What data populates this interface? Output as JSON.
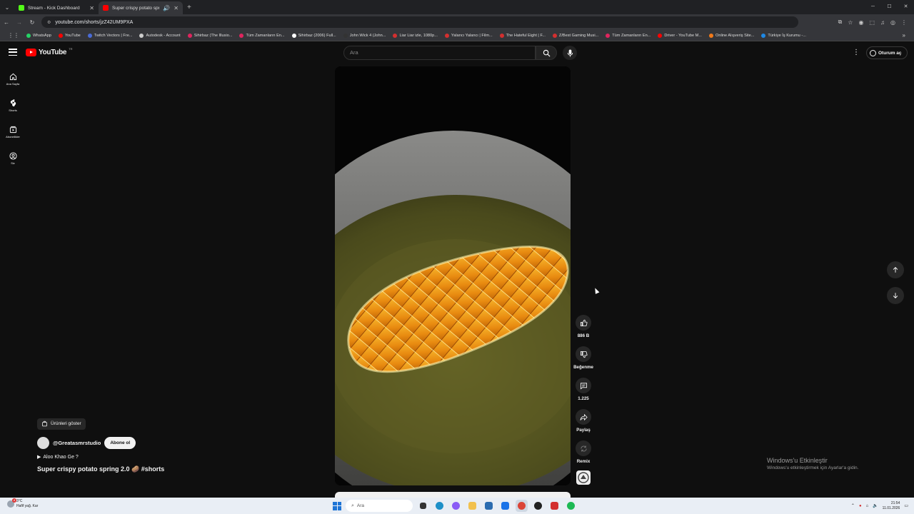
{
  "browser": {
    "tabs": [
      {
        "title": "Stream - Kick Dashboard",
        "favicon_color": "#53fc18",
        "active": false
      },
      {
        "title": "Super crispy potato spring",
        "favicon_color": "#ff0000",
        "active": true
      }
    ],
    "new_tab": "+",
    "window_controls": {
      "minimize": "─",
      "maximize": "☐",
      "close": "✕"
    },
    "url": "youtube.com/shorts/jzZ42UM9PXA",
    "bookmarks": [
      {
        "label": "WhatsApp",
        "color": "#25d366"
      },
      {
        "label": "YouTube",
        "color": "#ff0000"
      },
      {
        "label": "Twitch Vectors | Fre...",
        "color": "#4a6bd6"
      },
      {
        "label": "Autodesk - Account",
        "color": "#cccccc"
      },
      {
        "label": "Sihirbaz (The Illusio...",
        "color": "#e0245e"
      },
      {
        "label": "Tüm Zamanların En...",
        "color": "#e0245e"
      },
      {
        "label": "Sihirbaz (2006) Full...",
        "color": "#ffffff"
      },
      {
        "label": "John Wick 4 (John...",
        "color": "#333333"
      },
      {
        "label": "Liar Liar izle, 1080p...",
        "color": "#d32f2f"
      },
      {
        "label": "Yalancı Yalancı | Film...",
        "color": "#d32f2f"
      },
      {
        "label": "The Hateful Eight | F...",
        "color": "#d32f2f"
      },
      {
        "label": "Z/Best Gaming Musi...",
        "color": "#d32f2f"
      },
      {
        "label": "Tüm Zamanların En...",
        "color": "#e0245e"
      },
      {
        "label": "Driver - YouTube M...",
        "color": "#ff0000"
      },
      {
        "label": "Online Alışveriş Site...",
        "color": "#f27a1a"
      },
      {
        "label": "Türkiye İş Kurumu -...",
        "color": "#1e88e5"
      }
    ]
  },
  "youtube": {
    "logo_text": "YouTube",
    "logo_region": "TR",
    "search_placeholder": "Ara",
    "signin_label": "Oturum aç",
    "sidebar": [
      {
        "label": "Ana Sayfa",
        "icon": "home-icon"
      },
      {
        "label": "Shorts",
        "icon": "shorts-icon"
      },
      {
        "label": "Abonelikler",
        "icon": "subscriptions-icon"
      },
      {
        "label": "Siz",
        "icon": "you-icon"
      }
    ],
    "actions": {
      "like_count": "886 B",
      "dislike_label": "Beğenme",
      "comment_count": "1.225",
      "share_label": "Paylaş",
      "remix_label": "Remix"
    },
    "meta": {
      "products_label": "Ürünleri göster",
      "channel": "@Greatasmrstudio",
      "subscribe_label": "Abone ol",
      "music": "Aloo Khao Ge ?",
      "title": "Super crispy potato spring 2.0 🥔 #shorts"
    }
  },
  "watermark": {
    "line1": "Windows'u Etkinleştir",
    "line2": "Windows'u etkinleştirmek için Ayarlar'a gidin."
  },
  "taskbar": {
    "weather_temp": "3°C",
    "weather_desc": "Hafif yağ. Kar",
    "weather_badge": "2",
    "search_label": "Ara",
    "time": "21:54",
    "date": "11.01.2026"
  }
}
